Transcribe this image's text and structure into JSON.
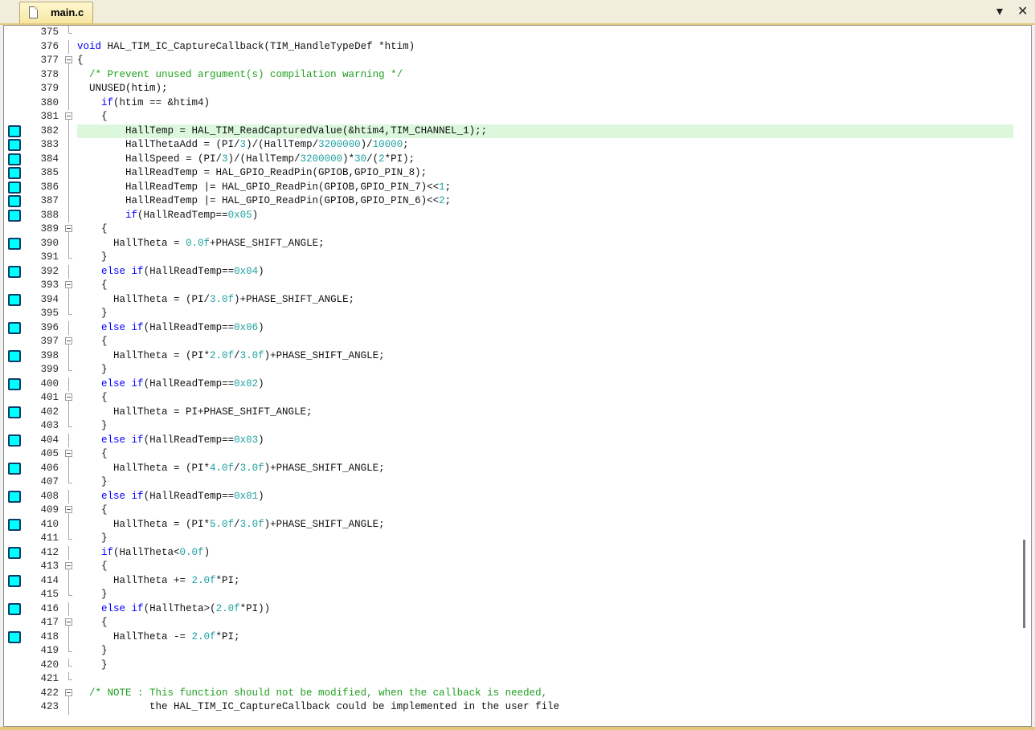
{
  "tab": {
    "label": "main.c"
  },
  "controls": {
    "dropdown_icon": "▾",
    "close_icon": "✕"
  },
  "editor": {
    "highlighted_line": "382",
    "lines": [
      {
        "n": "375",
        "code": ""
      },
      {
        "n": "376",
        "code": "void HAL_TIM_IC_CaptureCallback(TIM_HandleTypeDef *htim)"
      },
      {
        "n": "377",
        "code": "{"
      },
      {
        "n": "378",
        "code": "  /* Prevent unused argument(s) compilation warning */"
      },
      {
        "n": "379",
        "code": "  UNUSED(htim);"
      },
      {
        "n": "380",
        "code": "    if(htim == &htim4)"
      },
      {
        "n": "381",
        "code": "    {"
      },
      {
        "n": "382",
        "code": "        HallTemp = HAL_TIM_ReadCapturedValue(&htim4,TIM_CHANNEL_1);;"
      },
      {
        "n": "383",
        "code": "        HallThetaAdd = (PI/3)/(HallTemp/3200000)/10000;"
      },
      {
        "n": "384",
        "code": "        HallSpeed = (PI/3)/(HallTemp/3200000)*30/(2*PI);"
      },
      {
        "n": "385",
        "code": "        HallReadTemp = HAL_GPIO_ReadPin(GPIOB,GPIO_PIN_8);"
      },
      {
        "n": "386",
        "code": "        HallReadTemp |= HAL_GPIO_ReadPin(GPIOB,GPIO_PIN_7)<<1;"
      },
      {
        "n": "387",
        "code": "        HallReadTemp |= HAL_GPIO_ReadPin(GPIOB,GPIO_PIN_6)<<2;"
      },
      {
        "n": "388",
        "code": "        if(HallReadTemp==0x05)"
      },
      {
        "n": "389",
        "code": "    {"
      },
      {
        "n": "390",
        "code": "      HallTheta = 0.0f+PHASE_SHIFT_ANGLE;"
      },
      {
        "n": "391",
        "code": "    }"
      },
      {
        "n": "392",
        "code": "    else if(HallReadTemp==0x04)"
      },
      {
        "n": "393",
        "code": "    {"
      },
      {
        "n": "394",
        "code": "      HallTheta = (PI/3.0f)+PHASE_SHIFT_ANGLE;"
      },
      {
        "n": "395",
        "code": "    }"
      },
      {
        "n": "396",
        "code": "    else if(HallReadTemp==0x06)"
      },
      {
        "n": "397",
        "code": "    {"
      },
      {
        "n": "398",
        "code": "      HallTheta = (PI*2.0f/3.0f)+PHASE_SHIFT_ANGLE;"
      },
      {
        "n": "399",
        "code": "    }"
      },
      {
        "n": "400",
        "code": "    else if(HallReadTemp==0x02)"
      },
      {
        "n": "401",
        "code": "    {"
      },
      {
        "n": "402",
        "code": "      HallTheta = PI+PHASE_SHIFT_ANGLE;"
      },
      {
        "n": "403",
        "code": "    }"
      },
      {
        "n": "404",
        "code": "    else if(HallReadTemp==0x03)"
      },
      {
        "n": "405",
        "code": "    {"
      },
      {
        "n": "406",
        "code": "      HallTheta = (PI*4.0f/3.0f)+PHASE_SHIFT_ANGLE;"
      },
      {
        "n": "407",
        "code": "    }"
      },
      {
        "n": "408",
        "code": "    else if(HallReadTemp==0x01)"
      },
      {
        "n": "409",
        "code": "    {"
      },
      {
        "n": "410",
        "code": "      HallTheta = (PI*5.0f/3.0f)+PHASE_SHIFT_ANGLE;"
      },
      {
        "n": "411",
        "code": "    }"
      },
      {
        "n": "412",
        "code": "    if(HallTheta<0.0f)"
      },
      {
        "n": "413",
        "code": "    {"
      },
      {
        "n": "414",
        "code": "      HallTheta += 2.0f*PI;"
      },
      {
        "n": "415",
        "code": "    }"
      },
      {
        "n": "416",
        "code": "    else if(HallTheta>(2.0f*PI))"
      },
      {
        "n": "417",
        "code": "    {"
      },
      {
        "n": "418",
        "code": "      HallTheta -= 2.0f*PI;"
      },
      {
        "n": "419",
        "code": "    }"
      },
      {
        "n": "420",
        "code": "    }"
      },
      {
        "n": "421",
        "code": ""
      },
      {
        "n": "422",
        "code": "  /* NOTE : This function should not be modified, when the callback is needed,"
      },
      {
        "n": "423",
        "code": "            the HAL_TIM_IC_CaptureCallback could be implemented in the user file"
      }
    ],
    "breakpoint_lines": [
      "382",
      "383",
      "384",
      "385",
      "386",
      "387",
      "388",
      "390",
      "392",
      "394",
      "396",
      "398",
      "400",
      "402",
      "404",
      "406",
      "408",
      "410",
      "412",
      "414",
      "416",
      "418"
    ],
    "fold_open_lines": [
      "377",
      "381",
      "389",
      "393",
      "397",
      "401",
      "405",
      "409",
      "413",
      "417",
      "422"
    ],
    "fold_end_lines": [
      "391",
      "395",
      "399",
      "403",
      "407",
      "411",
      "415",
      "419",
      "420",
      "421"
    ]
  },
  "colors": {
    "keyword": "#0000ff",
    "number": "#21a0a0",
    "comment": "#1f9f1f",
    "breakpoint": "#00ffff",
    "highlight": "#dcf8dc"
  }
}
